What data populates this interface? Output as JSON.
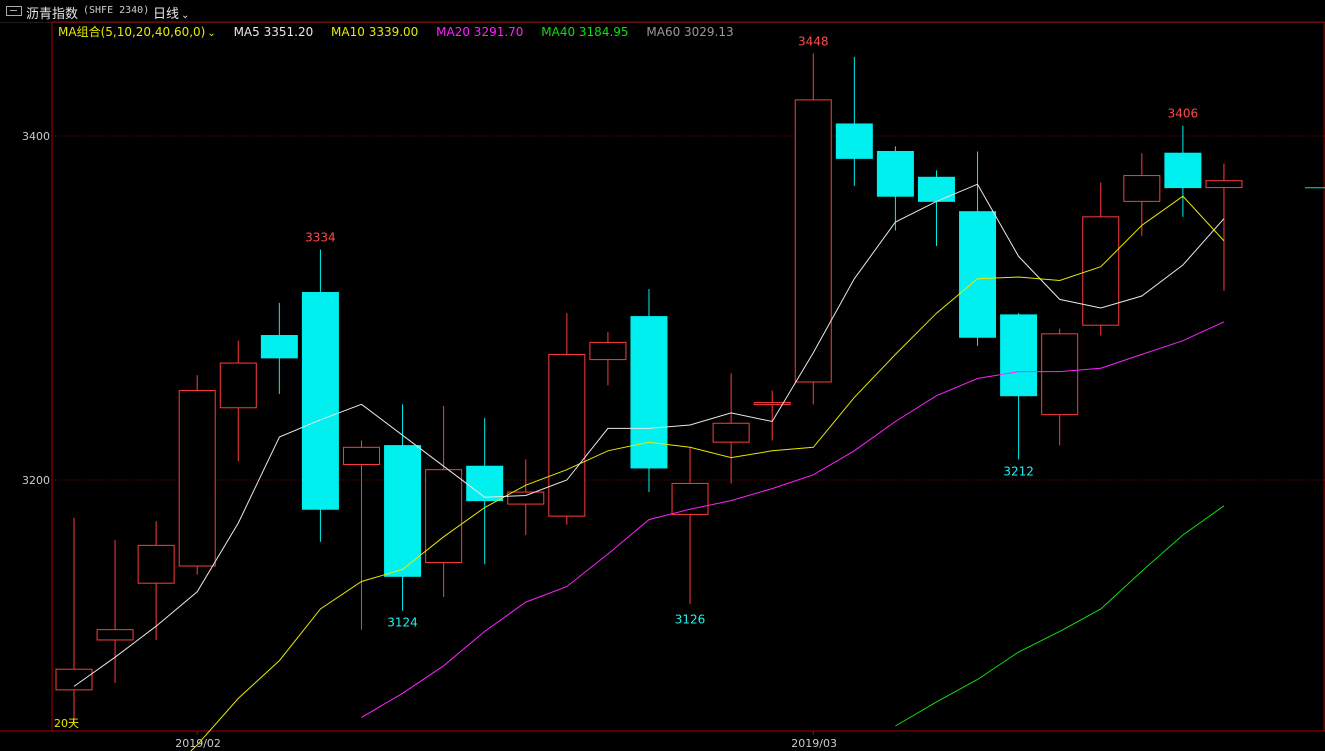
{
  "header": {
    "title": "沥青指数",
    "code": "(SHFE 2340)",
    "period": "日线",
    "period_chevron_icon": "chevron-down-icon",
    "menu_icon": "window-icon"
  },
  "legend": {
    "group_label": "MA组合(5,10,20,40,60,0)",
    "items": [
      {
        "label": "MA5 3351.20",
        "color": "#e8e8e8"
      },
      {
        "label": "MA10 3339.00",
        "color": "#e8e800"
      },
      {
        "label": "MA20 3291.70",
        "color": "#ff22ff"
      },
      {
        "label": "MA40 3184.95",
        "color": "#11dd11"
      },
      {
        "label": "MA60 3029.13",
        "color": "#999999"
      }
    ]
  },
  "chart_data": {
    "type": "candlestick",
    "title": "沥青指数 (SHFE 2340)",
    "period": "日线",
    "y_ticks": [
      3200,
      3400
    ],
    "ylim": [
      3055,
      3450
    ],
    "x_month_labels": [
      {
        "label": "2019/02",
        "index": 3
      },
      {
        "label": "2019/03",
        "index": 18
      }
    ],
    "colors": {
      "up": "#ff3b3b",
      "down": "#00f0f0",
      "grid": "#8a0000",
      "axis": "#aa0000",
      "ma5": "#e8e8e8",
      "ma10": "#e8e800",
      "ma20": "#ff22ff",
      "ma40": "#11dd11"
    },
    "candles": [
      {
        "o": 3078,
        "c": 3090,
        "h": 3178,
        "l": 3058
      },
      {
        "o": 3107,
        "c": 3113,
        "h": 3165,
        "l": 3082
      },
      {
        "o": 3140,
        "c": 3162,
        "h": 3176,
        "l": 3107
      },
      {
        "o": 3150,
        "c": 3252,
        "h": 3261,
        "l": 3145
      },
      {
        "o": 3242,
        "c": 3268,
        "h": 3281,
        "l": 3211
      },
      {
        "o": 3284,
        "c": 3271,
        "h": 3303,
        "l": 3250
      },
      {
        "o": 3309,
        "c": 3183,
        "h": 3334,
        "l": 3164
      },
      {
        "o": 3209,
        "c": 3219,
        "h": 3223,
        "l": 3113
      },
      {
        "o": 3220,
        "c": 3144,
        "h": 3244,
        "l": 3124
      },
      {
        "o": 3152,
        "c": 3206,
        "h": 3243,
        "l": 3132
      },
      {
        "o": 3208,
        "c": 3188,
        "h": 3236,
        "l": 3151
      },
      {
        "o": 3186,
        "c": 3193,
        "h": 3212,
        "l": 3168
      },
      {
        "o": 3179,
        "c": 3273,
        "h": 3297,
        "l": 3174
      },
      {
        "o": 3270,
        "c": 3280,
        "h": 3286,
        "l": 3255
      },
      {
        "o": 3295,
        "c": 3207,
        "h": 3311,
        "l": 3193
      },
      {
        "o": 3180,
        "c": 3198,
        "h": 3219,
        "l": 3128
      },
      {
        "o": 3222,
        "c": 3233,
        "h": 3262,
        "l": 3198
      },
      {
        "o": 3245,
        "c": 3245,
        "h": 3252,
        "l": 3223
      },
      {
        "o": 3257,
        "c": 3421,
        "h": 3448,
        "l": 3244
      },
      {
        "o": 3407,
        "c": 3387,
        "h": 3446,
        "l": 3371
      },
      {
        "o": 3391,
        "c": 3365,
        "h": 3394,
        "l": 3345
      },
      {
        "o": 3376,
        "c": 3362,
        "h": 3380,
        "l": 3336
      },
      {
        "o": 3356,
        "c": 3283,
        "h": 3391,
        "l": 3278
      },
      {
        "o": 3296,
        "c": 3249,
        "h": 3297,
        "l": 3212
      },
      {
        "o": 3238,
        "c": 3285,
        "h": 3288,
        "l": 3220
      },
      {
        "o": 3290,
        "c": 3353,
        "h": 3373,
        "l": 3284
      },
      {
        "o": 3362,
        "c": 3377,
        "h": 3390,
        "l": 3342
      },
      {
        "o": 3390,
        "c": 3370,
        "h": 3406,
        "l": 3353
      },
      {
        "o": 3370,
        "c": 3374,
        "h": 3384,
        "l": 3310
      }
    ],
    "ma5": [
      3080,
      3097,
      3115,
      3135,
      3175,
      3225,
      3235,
      3244,
      3226,
      3208,
      3190,
      3191,
      3200,
      3230,
      3230,
      3232,
      3239,
      3234,
      3274,
      3317,
      3350,
      3362,
      3372,
      3330,
      3305,
      3300,
      3307,
      3325,
      3352
    ],
    "ma10": [
      null,
      null,
      3023,
      3046,
      3073,
      3095,
      3125,
      3141,
      3148,
      3167,
      3184,
      3197,
      3206,
      3217,
      3222,
      3219,
      3213,
      3217,
      3219,
      3248,
      3273,
      3297,
      3317,
      3318,
      3316,
      3324,
      3348,
      3365,
      3339
    ],
    "ma20": [
      null,
      null,
      null,
      null,
      null,
      null,
      null,
      3062,
      3076,
      3092,
      3112,
      3129,
      3138,
      3157,
      3177,
      3183,
      3188,
      3195,
      3203,
      3217,
      3234,
      3249,
      3259,
      3263,
      3263,
      3265,
      3273,
      3281,
      3292
    ],
    "ma40": [
      null,
      null,
      null,
      null,
      null,
      null,
      null,
      null,
      null,
      null,
      null,
      null,
      null,
      null,
      null,
      null,
      null,
      null,
      null,
      null,
      3057,
      3071,
      3084,
      3100,
      3112,
      3125,
      3147,
      3168,
      3185
    ],
    "annotations": [
      {
        "index": 6,
        "value": 3334,
        "label": "3334",
        "type": "high"
      },
      {
        "index": 8,
        "value": 3124,
        "label": "3124",
        "type": "low"
      },
      {
        "index": 15,
        "value": 3126,
        "label": "3126",
        "type": "low"
      },
      {
        "index": 18,
        "value": 3448,
        "label": "3448",
        "type": "high"
      },
      {
        "index": 23,
        "value": 3212,
        "label": "3212",
        "type": "low"
      },
      {
        "index": 27,
        "value": 3406,
        "label": "3406",
        "type": "high"
      }
    ],
    "corner_label": "20天"
  }
}
